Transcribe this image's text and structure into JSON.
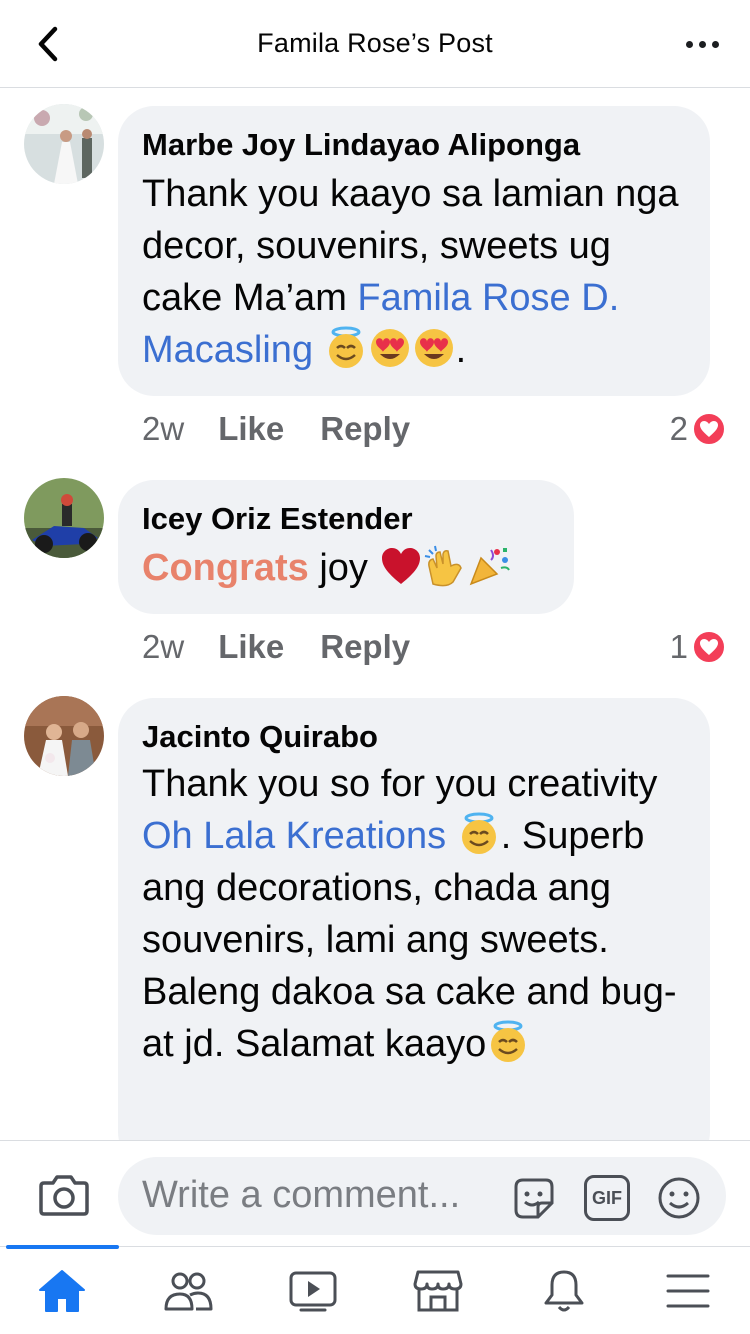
{
  "header": {
    "title": "Famila Rose’s Post",
    "back_icon": "chevron-left-icon",
    "more_icon": "more-dots-icon"
  },
  "comments": [
    {
      "author": "Marbe Joy Lindayao Aliponga",
      "text_before": "Thank you kaayo sa lamian nga decor, souvenirs, sweets ug cake Ma’am ",
      "mention": "Famila Rose D. Macasling",
      "text_after": ".",
      "emojis": [
        "smiling-halo-icon",
        "heart-eyes-icon",
        "heart-eyes-icon"
      ],
      "time": "2w",
      "like_label": "Like",
      "reply_label": "Reply",
      "reaction_count": "2",
      "reaction_icon": "heart-reaction-icon"
    },
    {
      "author": "Icey Oriz Estender",
      "highlight": "Congrats",
      "text_after": " joy ",
      "emojis": [
        "red-heart-icon",
        "clapping-hands-icon",
        "party-popper-icon"
      ],
      "time": "2w",
      "like_label": "Like",
      "reply_label": "Reply",
      "reaction_count": "1",
      "reaction_icon": "heart-reaction-icon"
    },
    {
      "author": "Jacinto Quirabo",
      "text_before": "Thank you so for you creativity ",
      "mention": "Oh Lala Kreations",
      "text_after": ". Superb ang decorations, chada ang souvenirs, lami ang sweets. Baleng dakoa sa cake and bug-at jd. Salamat kaayo",
      "emojis": [
        "smiling-halo-icon",
        "smiling-halo-icon"
      ]
    }
  ],
  "composer": {
    "placeholder": "Write a comment...",
    "camera_icon": "camera-icon",
    "sticker_icon": "sticker-icon",
    "gif_label": "GIF",
    "emoji_icon": "smiley-icon"
  },
  "nav": {
    "items": [
      "home-icon",
      "friends-icon",
      "watch-icon",
      "marketplace-icon",
      "notifications-icon",
      "menu-icon"
    ],
    "active": "home-icon",
    "active_color": "#1877f2"
  },
  "colors": {
    "bubble": "#f0f2f5",
    "mention": "#3b6fd1",
    "congrats": "#e8826b",
    "heart": "#f33e58",
    "secondary_text": "#65676b"
  }
}
